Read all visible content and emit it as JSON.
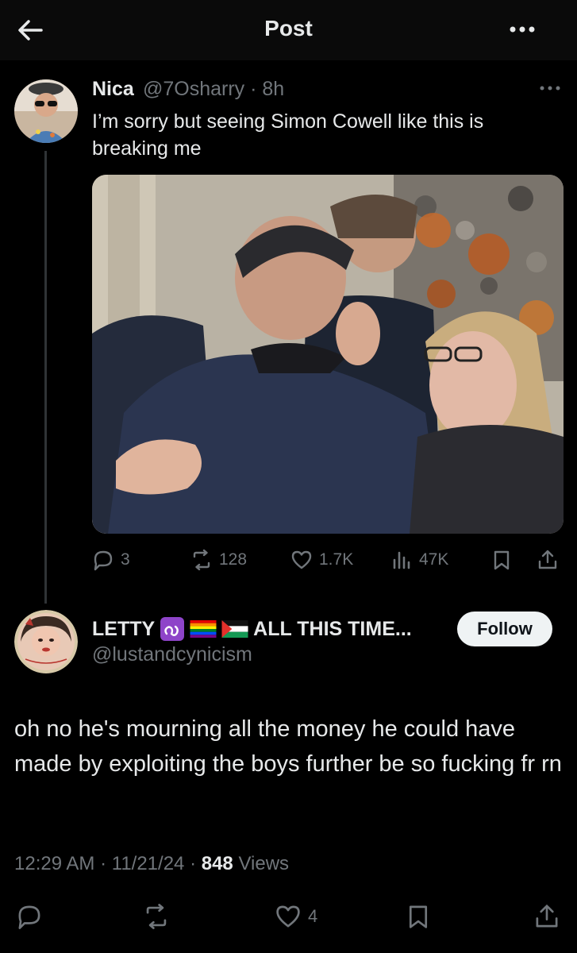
{
  "header": {
    "title": "Post",
    "back_icon": "arrow-left-icon",
    "more_icon": "more-horizontal-icon"
  },
  "quoted_post": {
    "name": "Nica",
    "handle_time": "@7Osharry · 8h",
    "text": "I’m sorry but seeing Simon Cowell like this is breaking me",
    "photo_icon": "photo-image",
    "actions": {
      "replies": "3",
      "reposts": "128",
      "likes": "1.7K",
      "views": "47K"
    }
  },
  "reply_post": {
    "name": "LETTY",
    "name_suffix": "ALL THIS TIME...",
    "badges": [
      "leo-zodiac-icon",
      "rainbow-flag-icon",
      "palestine-flag-icon"
    ],
    "handle": "@lustandcynicism",
    "follow_label": "Follow",
    "text": "oh no he's mourning all the money he could have made by exploiting the boys further be so fucking fr rn",
    "time": "12:29 AM",
    "date": "11/21/24",
    "views_count": "848",
    "views_label": "Views",
    "likes": "4"
  },
  "colors": {
    "background": "#000000",
    "text_primary": "#e7e9ea",
    "text_secondary": "#71767b",
    "follow_bg": "#eff3f4"
  }
}
